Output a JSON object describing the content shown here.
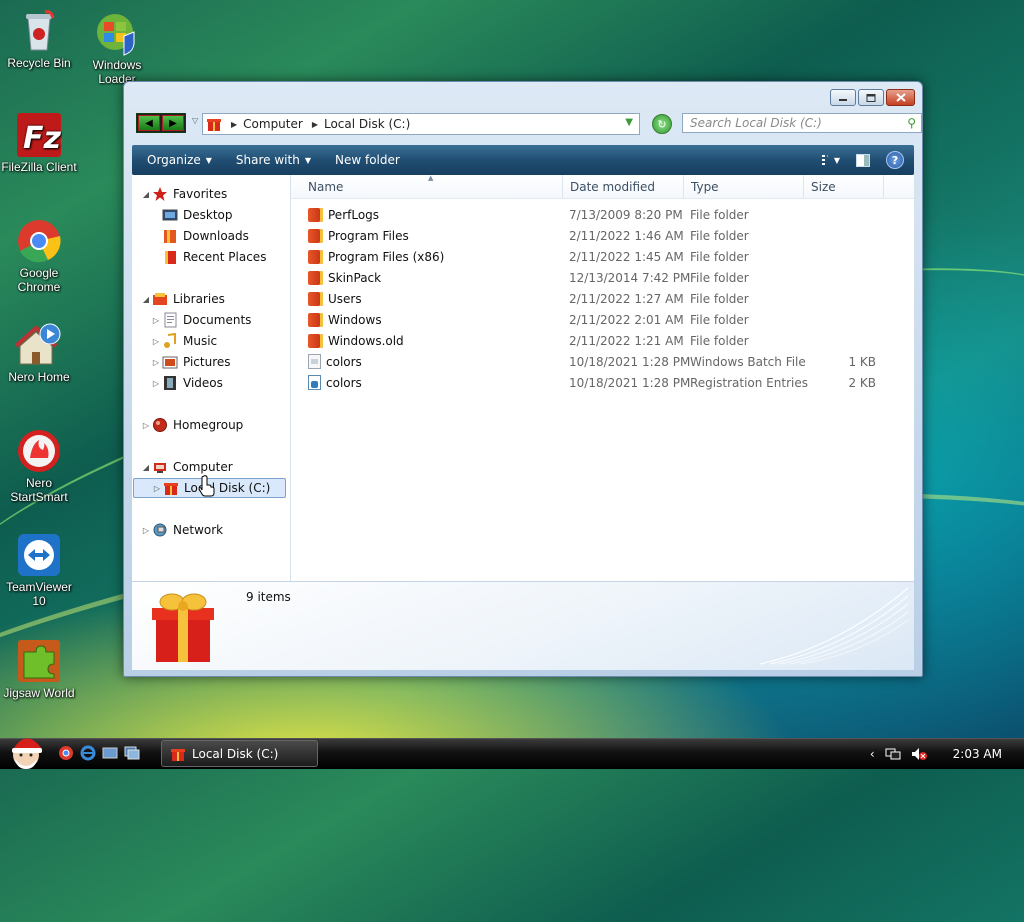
{
  "desktop": {
    "icons": [
      {
        "label": "Recycle Bin",
        "icon": "recycle-bin-icon"
      },
      {
        "label": "Windows\nLoader",
        "icon": "windows-loader-icon"
      },
      {
        "label": "FileZilla Client",
        "icon": "filezilla-icon"
      },
      {
        "label": "Google\nChrome",
        "icon": "chrome-icon"
      },
      {
        "label": "Nero Home",
        "icon": "nero-home-icon"
      },
      {
        "label": "Nero\nStartSmart",
        "icon": "nero-startsmart-icon"
      },
      {
        "label": "TeamViewer\n10",
        "icon": "teamviewer-icon"
      },
      {
        "label": "Jigsaw World",
        "icon": "jigsaw-world-icon"
      }
    ]
  },
  "window": {
    "address": {
      "root": "Computer",
      "current": "Local Disk (C:)"
    },
    "search": {
      "placeholder": "Search Local Disk (C:)"
    },
    "toolbar": {
      "organize": "Organize",
      "share": "Share with",
      "new_folder": "New folder"
    },
    "nav": {
      "favorites": "Favorites",
      "desktop": "Desktop",
      "downloads": "Downloads",
      "recent": "Recent Places",
      "libraries": "Libraries",
      "documents": "Documents",
      "music": "Music",
      "pictures": "Pictures",
      "videos": "Videos",
      "homegroup": "Homegroup",
      "computer": "Computer",
      "local_disk": "Local Disk (C:)",
      "network": "Network"
    },
    "columns": {
      "name": "Name",
      "date": "Date modified",
      "type": "Type",
      "size": "Size"
    },
    "files": [
      {
        "name": "PerfLogs",
        "date": "7/13/2009 8:20 PM",
        "type": "File folder",
        "size": "",
        "kind": "folder"
      },
      {
        "name": "Program Files",
        "date": "2/11/2022 1:46 AM",
        "type": "File folder",
        "size": "",
        "kind": "folder"
      },
      {
        "name": "Program Files (x86)",
        "date": "2/11/2022 1:45 AM",
        "type": "File folder",
        "size": "",
        "kind": "folder"
      },
      {
        "name": "SkinPack",
        "date": "12/13/2014 7:42 PM",
        "type": "File folder",
        "size": "",
        "kind": "folder"
      },
      {
        "name": "Users",
        "date": "2/11/2022 1:27 AM",
        "type": "File folder",
        "size": "",
        "kind": "folder"
      },
      {
        "name": "Windows",
        "date": "2/11/2022 2:01 AM",
        "type": "File folder",
        "size": "",
        "kind": "folder"
      },
      {
        "name": "Windows.old",
        "date": "2/11/2022 1:21 AM",
        "type": "File folder",
        "size": "",
        "kind": "folder"
      },
      {
        "name": "colors",
        "date": "10/18/2021 1:28 PM",
        "type": "Windows Batch File",
        "size": "1 KB",
        "kind": "batch"
      },
      {
        "name": "colors",
        "date": "10/18/2021 1:28 PM",
        "type": "Registration Entries",
        "size": "2 KB",
        "kind": "reg"
      }
    ],
    "details": {
      "item_count": "9 items"
    }
  },
  "taskbar": {
    "task_label": "Local Disk (C:)",
    "clock": "2:03 AM"
  },
  "colors": {
    "accent": "#1f4c70",
    "folder": "#d8401a"
  }
}
